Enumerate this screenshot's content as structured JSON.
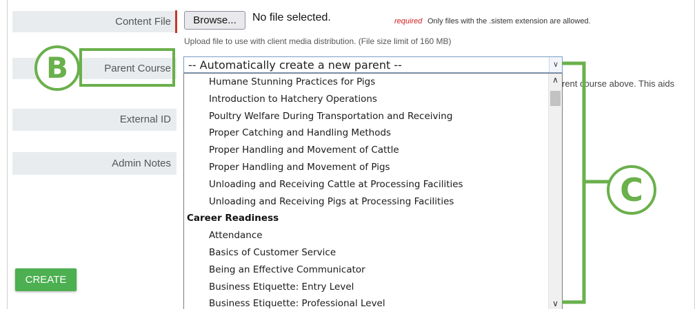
{
  "form": {
    "content_file_label": "Content File",
    "browse_label": "Browse...",
    "no_file_text": "No file selected.",
    "required_text": "required",
    "only_files_text": "Only files with the .sistem extension are allowed.",
    "upload_help": "Upload file to use with client media distribution. (File size limit of 160 MB)",
    "parent_course_label": "Parent Course",
    "parent_select_value": "-- Automatically create a new parent --",
    "parent_help_fragment": "rent course above. This aids",
    "external_id_label": "External ID",
    "admin_notes_label": "Admin Notes",
    "create_label": "CREATE"
  },
  "dropdown": {
    "items": [
      {
        "text": "Humane Stunning Practices for Pigs",
        "group": false
      },
      {
        "text": "Introduction to Hatchery Operations",
        "group": false
      },
      {
        "text": "Poultry Welfare During Transportation and Receiving",
        "group": false
      },
      {
        "text": "Proper Catching and Handling Methods",
        "group": false
      },
      {
        "text": "Proper Handling and Movement of Cattle",
        "group": false
      },
      {
        "text": "Proper Handling and Movement of Pigs",
        "group": false
      },
      {
        "text": "Unloading and Receiving Cattle at Processing Facilities",
        "group": false
      },
      {
        "text": "Unloading and Receiving Pigs at Processing Facilities",
        "group": false
      },
      {
        "text": "Career Readiness",
        "group": true
      },
      {
        "text": "Attendance",
        "group": false
      },
      {
        "text": "Basics of Customer Service",
        "group": false
      },
      {
        "text": "Being an Effective Communicator",
        "group": false
      },
      {
        "text": "Business Etiquette: Entry Level",
        "group": false
      },
      {
        "text": "Business Etiquette: Professional Level",
        "group": false
      }
    ]
  },
  "callouts": {
    "b_letter": "B",
    "c_letter": "C"
  },
  "colors": {
    "callout": "#6ab04c",
    "create_button": "#4caf50",
    "required": "#d01e1e",
    "label_bg": "#e9ecef"
  },
  "icons": {
    "select_arrow": "chevron-down-icon",
    "scroll_up": "scroll-up-arrow-icon",
    "scroll_down": "scroll-down-arrow-icon"
  }
}
